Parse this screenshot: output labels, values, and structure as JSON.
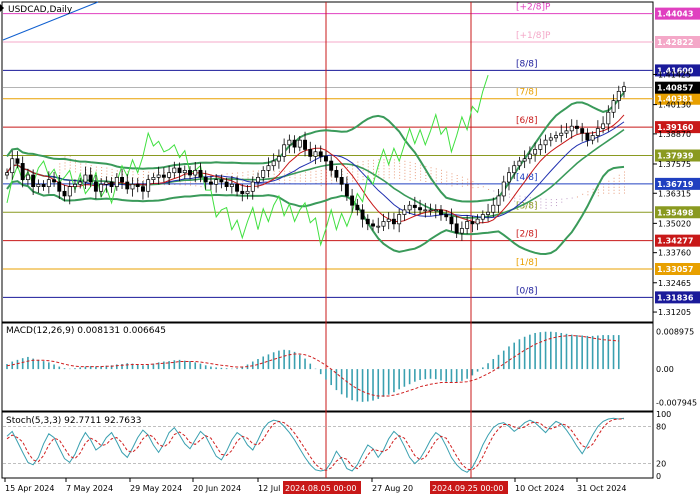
{
  "chart_data": [
    {
      "type": "candlestick",
      "title": "USDCAD,Daily",
      "ylim": [
        1.3082,
        1.445
      ],
      "x_ticks": [
        "15 Apr 2024",
        "7 May 2024",
        "29 May 2024",
        "20 Jun 2024",
        "12 Jul",
        "2024.08.05 00:00",
        "27 Aug 20",
        "2024.09.25 00:00",
        "10 Oct 2024",
        "31 Oct 2024"
      ],
      "y_ticks": [
        "1.41425",
        "1.40130",
        "1.38870",
        "1.37575",
        "1.36315",
        "1.35020",
        "1.33760",
        "1.32465",
        "1.31205"
      ],
      "vlines": [
        "2024.08.05 00:00",
        "2024.09.25 00:00"
      ],
      "levels": [
        {
          "value": 1.44043,
          "price": "1.44043",
          "label": "[+2/8]P",
          "color": "#e040c0"
        },
        {
          "value": 1.42822,
          "price": "1.42822",
          "label": "[+1/8]P",
          "color": "#f4a8c8"
        },
        {
          "value": 1.416,
          "price": "1.41600",
          "label": "[8/8]",
          "color": "#1a1a9a"
        },
        {
          "value": 1.40381,
          "price": "1.40381",
          "label": "[7/8]",
          "color": "#e8a000"
        },
        {
          "value": 1.3916,
          "price": "1.39160",
          "label": "[6/8]",
          "color": "#c81818"
        },
        {
          "value": 1.37939,
          "price": "1.37939",
          "label": "",
          "color": "#8a9a20"
        },
        {
          "value": 1.36719,
          "price": "1.36719",
          "label": "[4/8]",
          "color": "#2040c0"
        },
        {
          "value": 1.35498,
          "price": "1.35498",
          "label": "[3/8]",
          "color": "#8a9a20"
        },
        {
          "value": 1.34277,
          "price": "1.34277",
          "label": "[2/8]",
          "color": "#c81818"
        },
        {
          "value": 1.33057,
          "price": "1.33057",
          "label": "[1/8]",
          "color": "#e8a000"
        },
        {
          "value": 1.31836,
          "price": "1.31836",
          "label": "[0/8]",
          "color": "#1a1a9a"
        }
      ],
      "current_price": {
        "value": 1.40857,
        "label": "1.40857"
      },
      "close": [
        1.372,
        1.378,
        1.376,
        1.369,
        1.371,
        1.366,
        1.367,
        1.366,
        1.369,
        1.368,
        1.364,
        1.362,
        1.366,
        1.367,
        1.368,
        1.371,
        1.368,
        1.364,
        1.367,
        1.368,
        1.366,
        1.37,
        1.368,
        1.365,
        1.367,
        1.366,
        1.364,
        1.369,
        1.37,
        1.371,
        1.37,
        1.372,
        1.374,
        1.372,
        1.373,
        1.371,
        1.373,
        1.37,
        1.368,
        1.367,
        1.369,
        1.368,
        1.366,
        1.367,
        1.364,
        1.363,
        1.364,
        1.368,
        1.37,
        1.373,
        1.375,
        1.377,
        1.379,
        1.384,
        1.386,
        1.383,
        1.386,
        1.382,
        1.379,
        1.381,
        1.379,
        1.377,
        1.373,
        1.37,
        1.367,
        1.362,
        1.358,
        1.356,
        1.352,
        1.35,
        1.349,
        1.349,
        1.351,
        1.352,
        1.35,
        1.354,
        1.356,
        1.358,
        1.357,
        1.356,
        1.356,
        1.356,
        1.356,
        1.354,
        1.353,
        1.35,
        1.346,
        1.348,
        1.351,
        1.35,
        1.352,
        1.354,
        1.355,
        1.358,
        1.362,
        1.368,
        1.372,
        1.375,
        1.377,
        1.378,
        1.38,
        1.382,
        1.384,
        1.386,
        1.387,
        1.388,
        1.389,
        1.39,
        1.392,
        1.391,
        1.389,
        1.386,
        1.388,
        1.391,
        1.393,
        1.398,
        1.403,
        1.407,
        1.409
      ]
    },
    {
      "type": "line",
      "title": "MACD(12,26,9) 0.008131 0.006645",
      "ylim": [
        -0.0095,
        0.0105
      ],
      "y_ticks": [
        "0.008975",
        "0.00",
        "-0.007945"
      ],
      "histogram": [
        0.0012,
        0.0018,
        0.0022,
        0.0026,
        0.0029,
        0.0025,
        0.0022,
        0.0019,
        0.0016,
        0.0011,
        0.0006,
        0.0002,
        0.0001,
        0.0002,
        0.0004,
        0.0006,
        0.0007,
        0.0006,
        0.0007,
        0.0008,
        0.0009,
        0.0011,
        0.0012,
        0.0014,
        0.0013,
        0.0011,
        0.0009,
        0.0011,
        0.0013,
        0.0016,
        0.0018,
        0.0019,
        0.0021,
        0.0022,
        0.002,
        0.0019,
        0.0016,
        0.0013,
        0.0009,
        0.0006,
        0.0004,
        0.0003,
        0.0002,
        0.0001,
        0.0002,
        0.0006,
        0.0011,
        0.0018,
        0.0024,
        0.003,
        0.0035,
        0.004,
        0.0044,
        0.0046,
        0.0045,
        0.0041,
        0.0034,
        0.0025,
        0.0013,
        0.0001,
        -0.0012,
        -0.0025,
        -0.0038,
        -0.005,
        -0.006,
        -0.0068,
        -0.0074,
        -0.0077,
        -0.0078,
        -0.0077,
        -0.0075,
        -0.0071,
        -0.0066,
        -0.0061,
        -0.0055,
        -0.0048,
        -0.0042,
        -0.0036,
        -0.003,
        -0.0026,
        -0.0024,
        -0.0023,
        -0.0024,
        -0.0027,
        -0.003,
        -0.0032,
        -0.0031,
        -0.0028,
        -0.0023,
        -0.0015,
        -0.0006,
        0.0004,
        0.0014,
        0.0024,
        0.0034,
        0.0044,
        0.0054,
        0.0063,
        0.0071,
        0.0077,
        0.0082,
        0.0086,
        0.0088,
        0.0089,
        0.0089,
        0.0088,
        0.0086,
        0.0084,
        0.0082,
        0.0081,
        0.008,
        0.0079,
        0.0079,
        0.008,
        0.0081,
        0.0081,
        0.0081,
        0.0081
      ],
      "signal": [
        0.0008,
        0.001,
        0.0013,
        0.0016,
        0.0019,
        0.0021,
        0.0021,
        0.0021,
        0.002,
        0.0018,
        0.0015,
        0.0012,
        0.0009,
        0.0007,
        0.0006,
        0.0006,
        0.0006,
        0.0006,
        0.0006,
        0.0007,
        0.0007,
        0.0008,
        0.0009,
        0.001,
        0.0011,
        0.0011,
        0.0011,
        0.0011,
        0.0012,
        0.0013,
        0.0014,
        0.0015,
        0.0016,
        0.0018,
        0.0018,
        0.0018,
        0.0018,
        0.0017,
        0.0015,
        0.0013,
        0.0011,
        0.0009,
        0.0008,
        0.0006,
        0.0005,
        0.0005,
        0.0006,
        0.0008,
        0.0011,
        0.0015,
        0.0019,
        0.0023,
        0.0027,
        0.0031,
        0.0034,
        0.0036,
        0.0036,
        0.0034,
        0.003,
        0.0024,
        0.0017,
        0.0009,
        0.0,
        -0.001,
        -0.002,
        -0.003,
        -0.0039,
        -0.0047,
        -0.0053,
        -0.0058,
        -0.0062,
        -0.0064,
        -0.0064,
        -0.0064,
        -0.0062,
        -0.0059,
        -0.0055,
        -0.0051,
        -0.0047,
        -0.0042,
        -0.0039,
        -0.0036,
        -0.0034,
        -0.0032,
        -0.0032,
        -0.0032,
        -0.0032,
        -0.0031,
        -0.003,
        -0.0027,
        -0.0023,
        -0.0017,
        -0.0011,
        -0.0004,
        0.0004,
        0.0012,
        0.0021,
        0.0029,
        0.0037,
        0.0045,
        0.0052,
        0.0059,
        0.0064,
        0.0069,
        0.0073,
        0.0076,
        0.0078,
        0.0079,
        0.008,
        0.0079,
        0.0078,
        0.0076,
        0.0074,
        0.0072,
        0.007,
        0.0069,
        0.0068,
        0.0067
      ]
    },
    {
      "type": "line",
      "title": "Stoch(5,3,3) 92.7711 92.7633",
      "ylim": [
        0,
        100
      ],
      "y_ticks": [
        "100",
        "80",
        "20",
        "0"
      ],
      "levels": [
        80,
        20
      ],
      "main": [
        64,
        72,
        55,
        38,
        22,
        18,
        30,
        52,
        68,
        62,
        45,
        28,
        22,
        35,
        55,
        70,
        58,
        42,
        48,
        62,
        70,
        55,
        38,
        30,
        45,
        62,
        74,
        66,
        50,
        38,
        52,
        70,
        78,
        66,
        52,
        44,
        58,
        72,
        64,
        48,
        32,
        26,
        40,
        58,
        70,
        64,
        50,
        42,
        58,
        76,
        86,
        90,
        88,
        80,
        70,
        58,
        44,
        30,
        18,
        10,
        8,
        10,
        22,
        40,
        28,
        12,
        8,
        18,
        35,
        50,
        44,
        30,
        42,
        60,
        72,
        64,
        48,
        30,
        20,
        28,
        42,
        58,
        70,
        64,
        48,
        30,
        18,
        10,
        6,
        14,
        30,
        50,
        66,
        78,
        84,
        86,
        80,
        72,
        78,
        86,
        90,
        86,
        78,
        70,
        80,
        88,
        84,
        74,
        62,
        48,
        36,
        50,
        66,
        80,
        88,
        92,
        93,
        92,
        93
      ],
      "signal": [
        60,
        66,
        62,
        55,
        38,
        26,
        23,
        33,
        50,
        61,
        58,
        45,
        32,
        28,
        37,
        53,
        61,
        57,
        49,
        51,
        60,
        62,
        54,
        41,
        38,
        46,
        60,
        67,
        63,
        51,
        47,
        53,
        67,
        71,
        65,
        54,
        51,
        58,
        65,
        61,
        48,
        35,
        33,
        41,
        56,
        64,
        61,
        52,
        50,
        59,
        73,
        84,
        88,
        86,
        79,
        69,
        57,
        44,
        31,
        19,
        12,
        9,
        13,
        24,
        30,
        27,
        16,
        12,
        20,
        34,
        43,
        41,
        39,
        44,
        58,
        65,
        61,
        47,
        33,
        26,
        30,
        43,
        57,
        64,
        61,
        47,
        32,
        19,
        11,
        10,
        17,
        31,
        49,
        65,
        76,
        83,
        83,
        79,
        77,
        79,
        85,
        87,
        85,
        78,
        76,
        79,
        84,
        82,
        73,
        61,
        49,
        45,
        51,
        65,
        78,
        87,
        91,
        92,
        92
      ]
    }
  ]
}
